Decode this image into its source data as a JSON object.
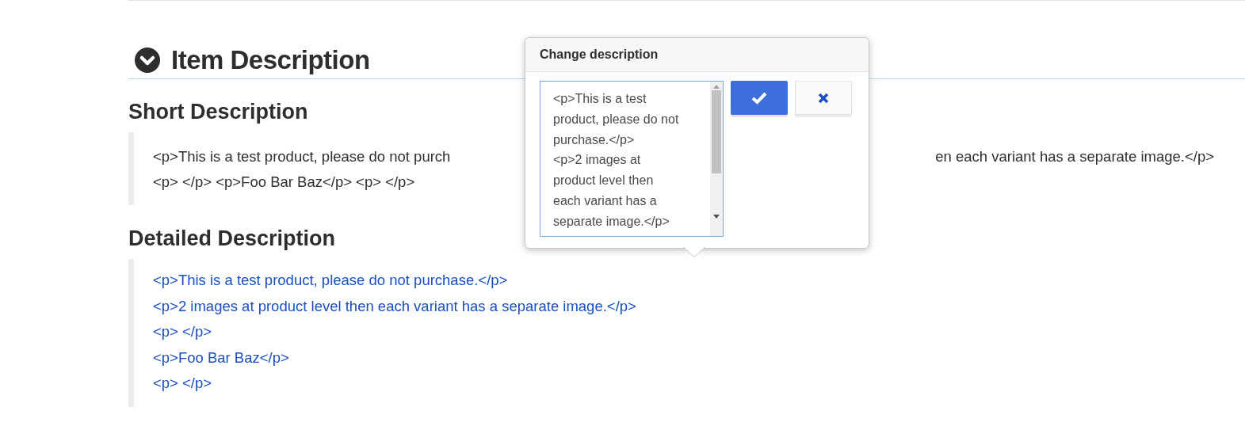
{
  "section": {
    "title": "Item Description",
    "expanded": true
  },
  "short_description": {
    "heading": "Short Description",
    "line_1_start": "<p>This is a test product, please do not purch",
    "line_1_end": "en each variant has a separate image.</p>",
    "line_2": "<p> </p> <p>Foo Bar Baz</p> <p> </p>"
  },
  "detailed_description": {
    "heading": "Detailed Description",
    "lines": [
      "<p>This is a test product, please do not purchase.</p>",
      "<p>2 images at product level then each variant has a separate image.</p>",
      "<p> </p>",
      "<p>Foo Bar Baz</p>",
      "<p> </p>"
    ]
  },
  "popover": {
    "title": "Change description",
    "value": "<p>This is a test product, please do not purchase.</p>\n<p>2 images at product level then each variant has a separate image.</p>"
  }
}
